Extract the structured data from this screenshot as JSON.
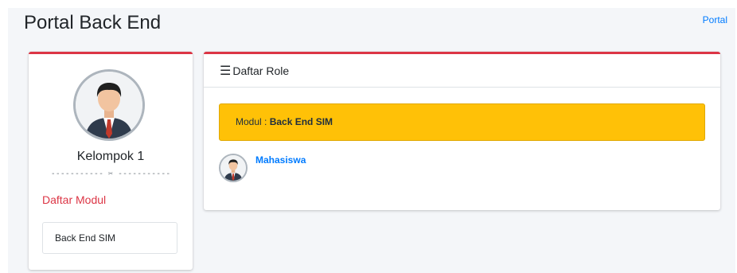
{
  "header": {
    "title": "Portal Back End",
    "portal_link": "Portal"
  },
  "profile": {
    "name": "Kelompok 1",
    "divider": "----------- ✂ -----------",
    "modul_heading": "Daftar Modul",
    "modul_items": [
      {
        "label": "Back End SIM"
      }
    ]
  },
  "role_panel": {
    "title": "Daftar Role",
    "title_icon": "bars-icon",
    "alert": {
      "prefix": "Modul : ",
      "value": "Back End SIM"
    },
    "roles": [
      {
        "name": "Mahasiswa",
        "icon": "user-avatar-icon"
      }
    ]
  },
  "colors": {
    "accent_border": "#dc3545",
    "alert_bg": "#ffc107",
    "link": "#007bff",
    "background": "#f4f6f9"
  }
}
